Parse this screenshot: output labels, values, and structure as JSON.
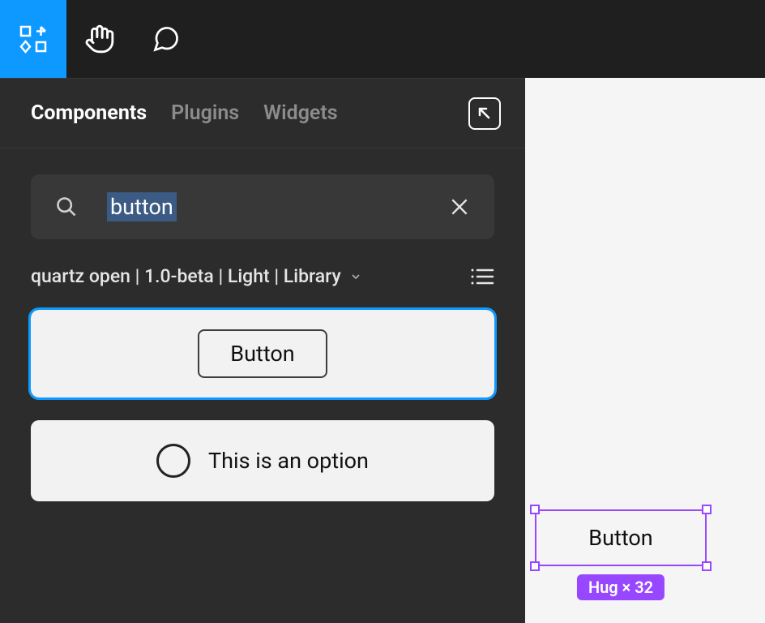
{
  "toolbar": {
    "items": [
      "resources-icon",
      "hand-icon",
      "comment-icon"
    ],
    "active_index": 0
  },
  "panel": {
    "tabs": [
      {
        "label": "Components",
        "active": true
      },
      {
        "label": "Plugins",
        "active": false
      },
      {
        "label": "Widgets",
        "active": false
      }
    ],
    "expand_icon": "expand-corner-icon",
    "search": {
      "value": "button",
      "selected": true,
      "icon": "search-icon",
      "clear_icon": "close-icon"
    },
    "breadcrumb": {
      "text": "quartz open | 1.0-beta | Light | Library",
      "has_dropdown": true,
      "view_icon": "list-view-icon"
    },
    "results": [
      {
        "kind": "button",
        "label": "Button",
        "selected": true
      },
      {
        "kind": "option",
        "label": "This is an option",
        "selected": false
      }
    ]
  },
  "canvas": {
    "selection": {
      "label": "Button",
      "size_badge": "Hug × 32",
      "outline_color": "#9747ff"
    }
  },
  "colors": {
    "accent": "#0d99ff",
    "component_purple": "#9747ff",
    "panel_bg": "#2c2c2c",
    "topbar_bg": "#1f1f1f"
  }
}
